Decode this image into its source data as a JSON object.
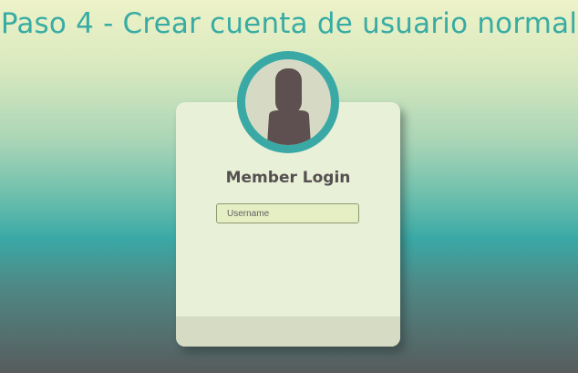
{
  "slide": {
    "title": "Paso 4 - Crear cuenta de usuario normal"
  },
  "login": {
    "heading": "Member Login",
    "username_placeholder": "Username",
    "avatar_icon": "user-silhouette-icon"
  },
  "colors": {
    "accent": "#3aa9a6",
    "card": "#e8f0d7",
    "footer": "#d6dbc4",
    "avatar_fill": "#5e5050",
    "heading_text": "#555050"
  }
}
